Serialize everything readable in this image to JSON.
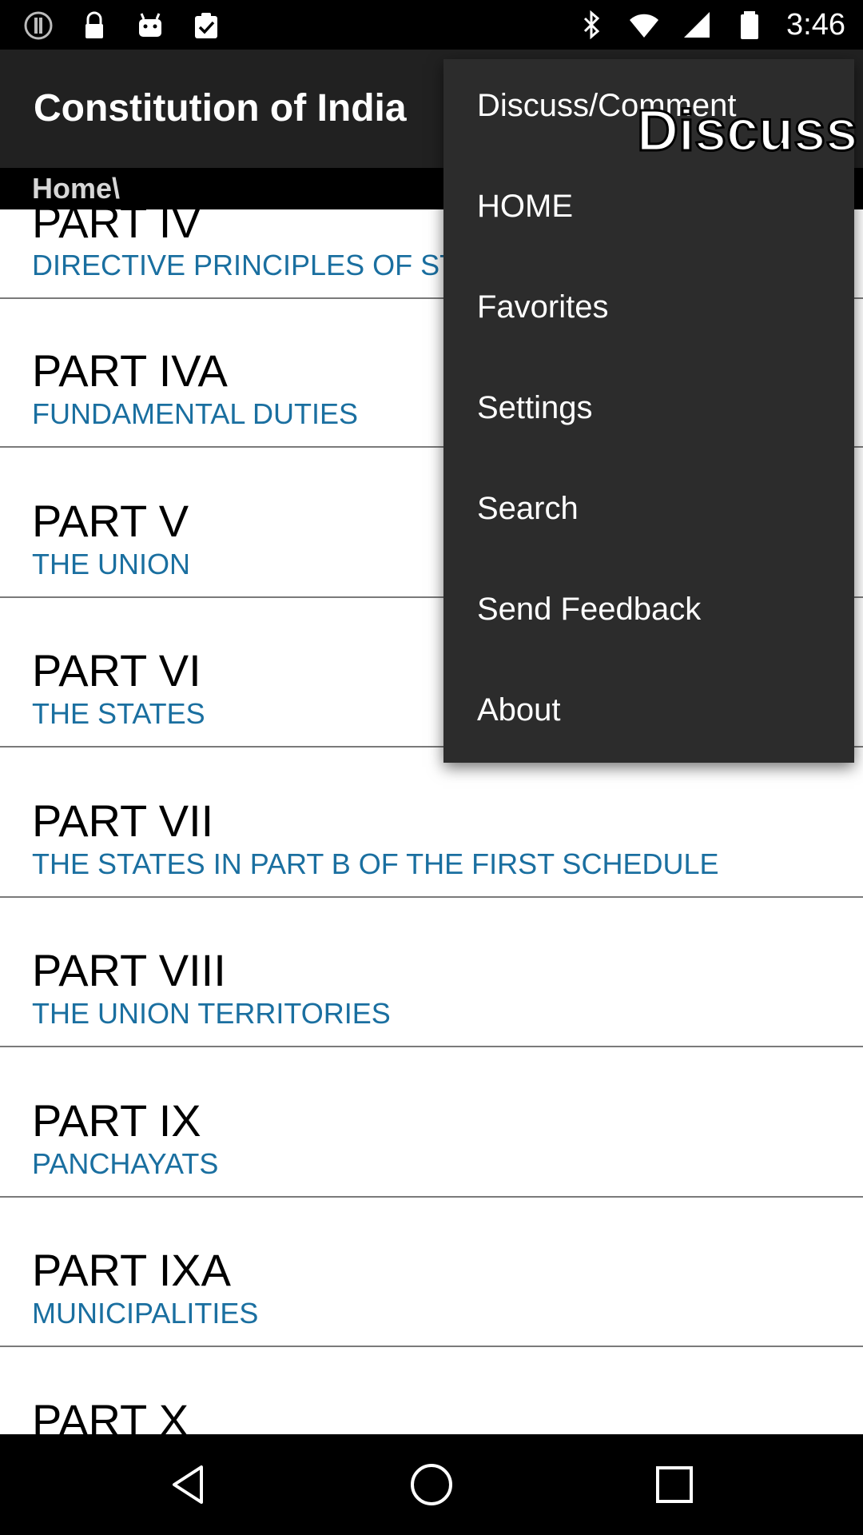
{
  "status_bar": {
    "time": "3:46",
    "left_icons": [
      "alert-icon",
      "lock-icon",
      "android-icon",
      "clipboard-check-icon"
    ],
    "right_icons": [
      "bluetooth-icon",
      "wifi-icon",
      "signal-icon",
      "battery-icon"
    ]
  },
  "app_bar": {
    "title": "Constitution of India"
  },
  "breadcrumb": "Home\\",
  "parts": [
    {
      "title": "PART IV",
      "subtitle": "DIRECTIVE PRINCIPLES OF ST"
    },
    {
      "title": "PART IVA",
      "subtitle": "FUNDAMENTAL DUTIES"
    },
    {
      "title": "PART V",
      "subtitle": "THE UNION"
    },
    {
      "title": "PART VI",
      "subtitle": "THE STATES"
    },
    {
      "title": "PART VII",
      "subtitle": "THE STATES IN PART B OF THE FIRST SCHEDULE"
    },
    {
      "title": "PART VIII",
      "subtitle": "THE UNION TERRITORIES"
    },
    {
      "title": "PART IX",
      "subtitle": "PANCHAYATS"
    },
    {
      "title": "PART IXA",
      "subtitle": "MUNICIPALITIES"
    },
    {
      "title": "PART X",
      "subtitle": ""
    }
  ],
  "menu": {
    "items": [
      {
        "label": "Discuss/Comment"
      },
      {
        "label": "HOME"
      },
      {
        "label": "Favorites"
      },
      {
        "label": "Settings"
      },
      {
        "label": "Search"
      },
      {
        "label": "Send Feedback"
      },
      {
        "label": "About"
      }
    ],
    "overlay_text": "Discuss"
  },
  "nav_bar": {
    "icons": [
      "back-icon",
      "home-icon",
      "recents-icon"
    ]
  },
  "colors": {
    "app_bar": "#212121",
    "menu_bg": "#2c2c2c",
    "subtitle": "#1a6fa0"
  }
}
